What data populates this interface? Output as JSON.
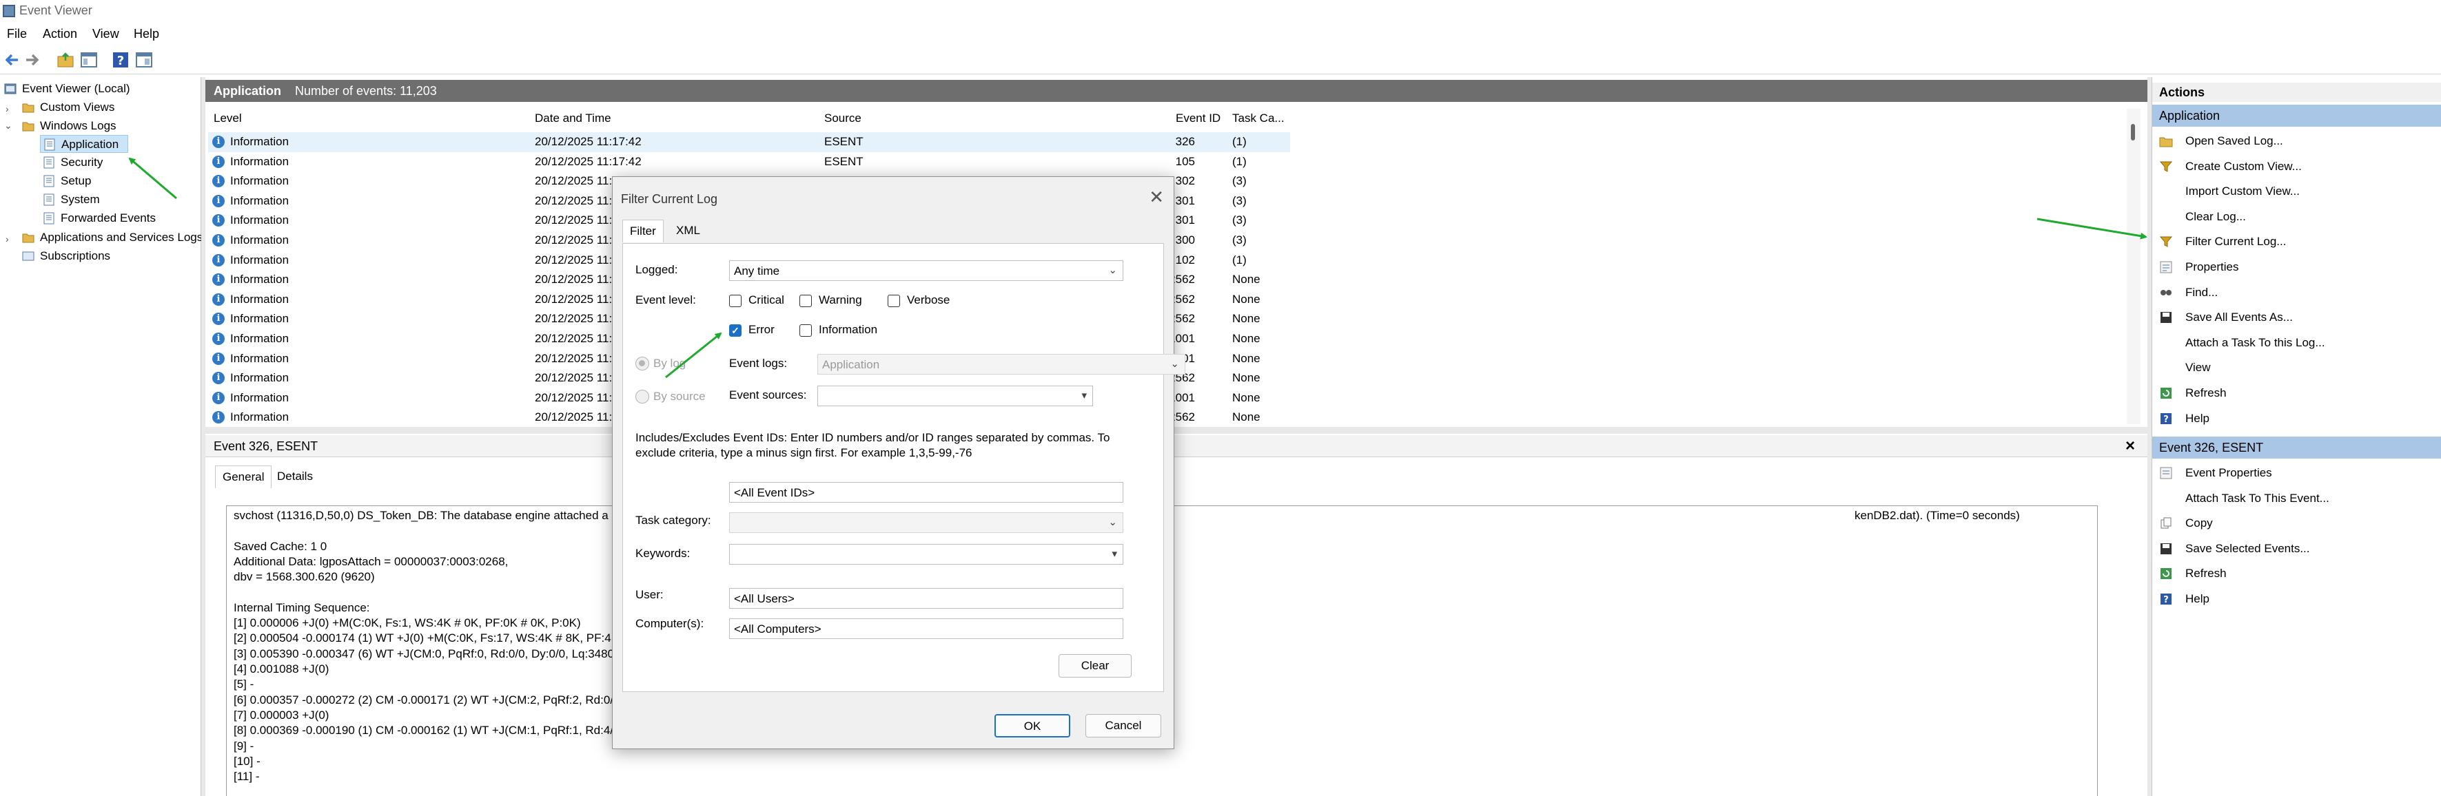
{
  "window": {
    "title": "Event Viewer"
  },
  "menu": [
    "File",
    "Action",
    "View",
    "Help"
  ],
  "toolbar": [
    "back-icon",
    "forward-icon",
    "folder-up-icon",
    "show-hide-tree-icon",
    "help-icon",
    "show-hide-action-pane-icon"
  ],
  "tree": {
    "root": "Event Viewer (Local)",
    "custom_views": "Custom Views",
    "windows_logs": "Windows Logs",
    "application": "Application",
    "security": "Security",
    "setup": "Setup",
    "system": "System",
    "forwarded": "Forwarded Events",
    "apps_services": "Applications and Services Logs",
    "subscriptions": "Subscriptions"
  },
  "center": {
    "title": "Application",
    "count": "Number of events: 11,203",
    "columns": [
      "Level",
      "Date and Time",
      "Source",
      "Event ID",
      "Task Ca..."
    ],
    "rows": [
      {
        "level": "Information",
        "date": "20/12/2025 11:17:42",
        "source": "ESENT",
        "id": "326",
        "task": "(1)"
      },
      {
        "level": "Information",
        "date": "20/12/2025 11:17:42",
        "source": "ESENT",
        "id": "105",
        "task": "(1)"
      },
      {
        "level": "Information",
        "date": "20/12/2025 11:17:42",
        "source": "ESENT",
        "id": "302",
        "task": "(3)"
      },
      {
        "level": "Information",
        "date": "20/12/2025 11:",
        "source": "",
        "id": "301",
        "task": "(3)"
      },
      {
        "level": "Information",
        "date": "20/12/2025 11:",
        "source": "",
        "id": "301",
        "task": "(3)"
      },
      {
        "level": "Information",
        "date": "20/12/2025 11:",
        "source": "",
        "id": "300",
        "task": "(3)"
      },
      {
        "level": "Information",
        "date": "20/12/2025 11:",
        "source": "",
        "id": "102",
        "task": "(1)"
      },
      {
        "level": "Information",
        "date": "20/12/2025 11:",
        "source": "",
        "id": "2562",
        "task": "None"
      },
      {
        "level": "Information",
        "date": "20/12/2025 11:",
        "source": "",
        "id": "2562",
        "task": "None"
      },
      {
        "level": "Information",
        "date": "20/12/2025 11:",
        "source": "",
        "id": "2562",
        "task": "None"
      },
      {
        "level": "Information",
        "date": "20/12/2025 11:",
        "source": "",
        "id": "1001",
        "task": "None"
      },
      {
        "level": "Information",
        "date": "20/12/2025 11:",
        "source": "",
        "id": "1001",
        "task": "None"
      },
      {
        "level": "Information",
        "date": "20/12/2025 11:",
        "source": "",
        "id": "2562",
        "task": "None"
      },
      {
        "level": "Information",
        "date": "20/12/2025 11:",
        "source": "",
        "id": "1001",
        "task": "None"
      },
      {
        "level": "Information",
        "date": "20/12/2025 11:",
        "source": "",
        "id": "2562",
        "task": "None"
      }
    ]
  },
  "detail": {
    "title": "Event 326, ESENT",
    "close": "×",
    "tabs": [
      "General",
      "Details"
    ],
    "lines": [
      "svchost (11316,D,50,0) DS_Token_DB: The database engine attached a",
      "",
      "Saved Cache: 1 0",
      "Additional Data: lgposAttach = 00000037:0003:0268,",
      "dbv = 1568.300.620 (9620)",
      "",
      "Internal Timing Sequence:",
      "[1] 0.000006 +J(0) +M(C:0K, Fs:1, WS:4K # 0K, PF:0K # 0K, P:0K)",
      "[2] 0.000504 -0.000174 (1) WT +J(0) +M(C:0K, Fs:17, WS:4K # 8K, PF:4K",
      "[3] 0.005390 -0.000347 (6) WT +J(CM:0, PqRf:0, Rd:0/0, Dy:0/0, Lq:3480",
      "[4] 0.001088 +J(0)",
      "[5] -",
      "[6] 0.000357 -0.000272 (2) CM -0.000171 (2) WT +J(CM:2, PqRf:2, Rd:0/",
      "[7] 0.000003 +J(0)",
      "[8] 0.000369 -0.000190 (1) CM -0.000162 (1) WT +J(CM:1, PqRf:1, Rd:4/",
      "[9] -",
      "[10] -",
      "[11] -"
    ],
    "tail_text": "kenDB2.dat). (Time=0 seconds)"
  },
  "actions": {
    "title": "Actions",
    "section1": "Application",
    "items1": [
      "Open Saved Log...",
      "Create Custom View...",
      "Import Custom View...",
      "Clear Log...",
      "Filter Current Log...",
      "Properties",
      "Find...",
      "Save All Events As...",
      "Attach a Task To this Log...",
      "View",
      "Refresh",
      "Help"
    ],
    "section2": "Event 326, ESENT",
    "items2": [
      "Event Properties",
      "Attach Task To This Event...",
      "Copy",
      "Save Selected Events...",
      "Refresh",
      "Help"
    ]
  },
  "dialog": {
    "title": "Filter Current Log",
    "close": "✕",
    "tabs": [
      "Filter",
      "XML"
    ],
    "logged_label": "Logged:",
    "logged_value": "Any time",
    "event_level_label": "Event level:",
    "levels": [
      {
        "label": "Critical",
        "checked": false
      },
      {
        "label": "Warning",
        "checked": false
      },
      {
        "label": "Verbose",
        "checked": false
      },
      {
        "label": "Error",
        "checked": true
      },
      {
        "label": "Information",
        "checked": false
      }
    ],
    "by_log": "By log",
    "by_source": "By source",
    "event_logs_label": "Event logs:",
    "event_logs_value": "Application",
    "event_sources_label": "Event sources:",
    "help_text_1": "Includes/Excludes Event IDs: Enter ID numbers and/or ID ranges separated by commas. To",
    "help_text_2": "exclude criteria, type a minus sign first. For example 1,3,5-99,-76",
    "event_ids_value": "<All Event IDs>",
    "task_category_label": "Task category:",
    "keywords_label": "Keywords:",
    "user_label": "User:",
    "user_value": "<All Users>",
    "computer_label": "Computer(s):",
    "computer_value": "<All Computers>",
    "clear": "Clear",
    "ok": "OK",
    "cancel": "Cancel"
  },
  "colors": {
    "accent": "#1a6fc6",
    "annotation_arrow": "#1faa2f",
    "header_bar": "#6e6e6e",
    "action_section": "#a9c6e6"
  }
}
